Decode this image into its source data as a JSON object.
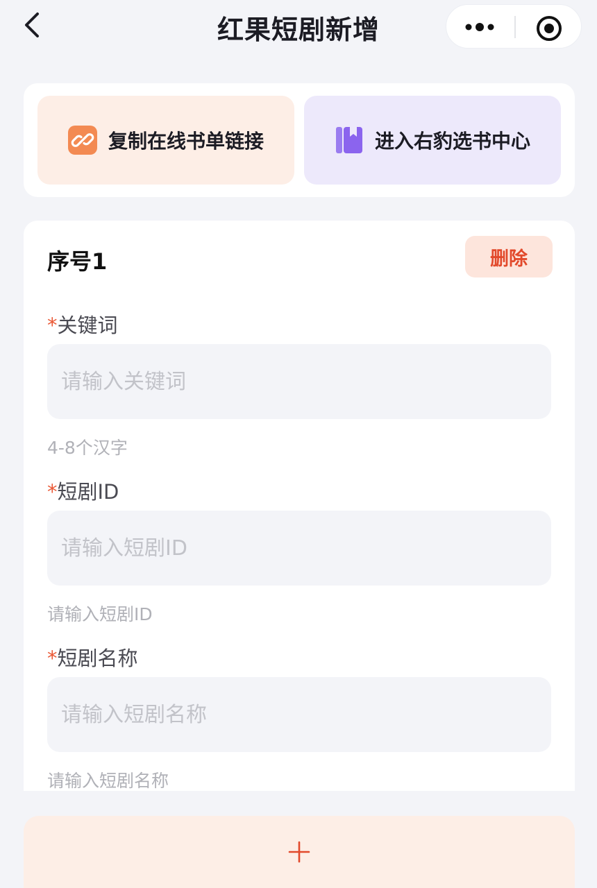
{
  "header": {
    "title": "红果短剧新增",
    "back_icon": "chevron-left-icon",
    "more_icon": "more-dots-icon",
    "close_icon": "target-circle-icon"
  },
  "actions": {
    "copy_label": "复制在线书单链接",
    "copy_icon": "link-icon",
    "enter_label": "进入右豹选书中心",
    "enter_icon": "book-icon"
  },
  "item": {
    "title": "序号1",
    "delete_label": "删除",
    "fields": [
      {
        "required_mark": "*",
        "label": "关键词",
        "placeholder": "请输入关键词",
        "hint": "4-8个汉字"
      },
      {
        "required_mark": "*",
        "label": "短剧ID",
        "placeholder": "请输入短剧ID",
        "hint": "请输入短剧ID"
      },
      {
        "required_mark": "*",
        "label": "短剧名称",
        "placeholder": "请输入短剧名称",
        "hint": "请输入短剧名称"
      }
    ]
  },
  "add_button": {
    "icon": "plus-icon"
  },
  "colors": {
    "accent": "#ea5a37",
    "copy_bg": "#fdeee6",
    "enter_bg": "#ede9fb",
    "page_bg": "#f3f4f8"
  }
}
